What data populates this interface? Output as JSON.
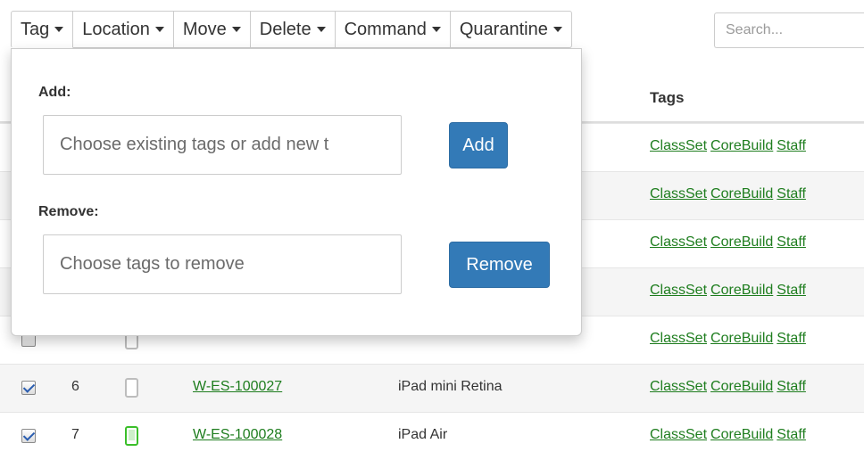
{
  "toolbar": {
    "tag": "Tag",
    "location": "Location",
    "move": "Move",
    "delete": "Delete",
    "command": "Command",
    "quarantine": "Quarantine"
  },
  "search": {
    "placeholder": "Search..."
  },
  "table": {
    "headers": {
      "tags": "Tags"
    },
    "rows": [
      {
        "num": "",
        "asset": "",
        "model": "",
        "checked": false,
        "tags": [
          "ClassSet",
          "CoreBuild",
          "Staff"
        ]
      },
      {
        "num": "",
        "asset": "",
        "model": "",
        "checked": false,
        "tags": [
          "ClassSet",
          "CoreBuild",
          "Staff"
        ]
      },
      {
        "num": "",
        "asset": "",
        "model": "",
        "checked": false,
        "tags": [
          "ClassSet",
          "CoreBuild",
          "Staff"
        ]
      },
      {
        "num": "",
        "asset": "",
        "model": "",
        "checked": false,
        "tags": [
          "ClassSet",
          "CoreBuild",
          "Staff"
        ]
      },
      {
        "num": "",
        "asset": "",
        "model": "",
        "checked": false,
        "tags": [
          "ClassSet",
          "CoreBuild",
          "Staff"
        ]
      },
      {
        "num": "6",
        "asset": "W-ES-100027",
        "model": "iPad mini Retina",
        "checked": true,
        "tags": [
          "ClassSet",
          "CoreBuild",
          "Staff"
        ]
      },
      {
        "num": "7",
        "asset": "W-ES-100028",
        "model": "iPad Air",
        "checked": true,
        "tags": [
          "ClassSet",
          "CoreBuild",
          "Staff"
        ]
      }
    ]
  },
  "popover": {
    "add_label": "Add:",
    "add_placeholder": "Choose existing tags or add new t",
    "add_button": "Add",
    "remove_label": "Remove:",
    "remove_placeholder": "Choose tags to remove",
    "remove_button": "Remove"
  },
  "colors": {
    "primary": "#337ab7",
    "link": "#1e7d1e",
    "device_active": "#3bbf2a"
  }
}
